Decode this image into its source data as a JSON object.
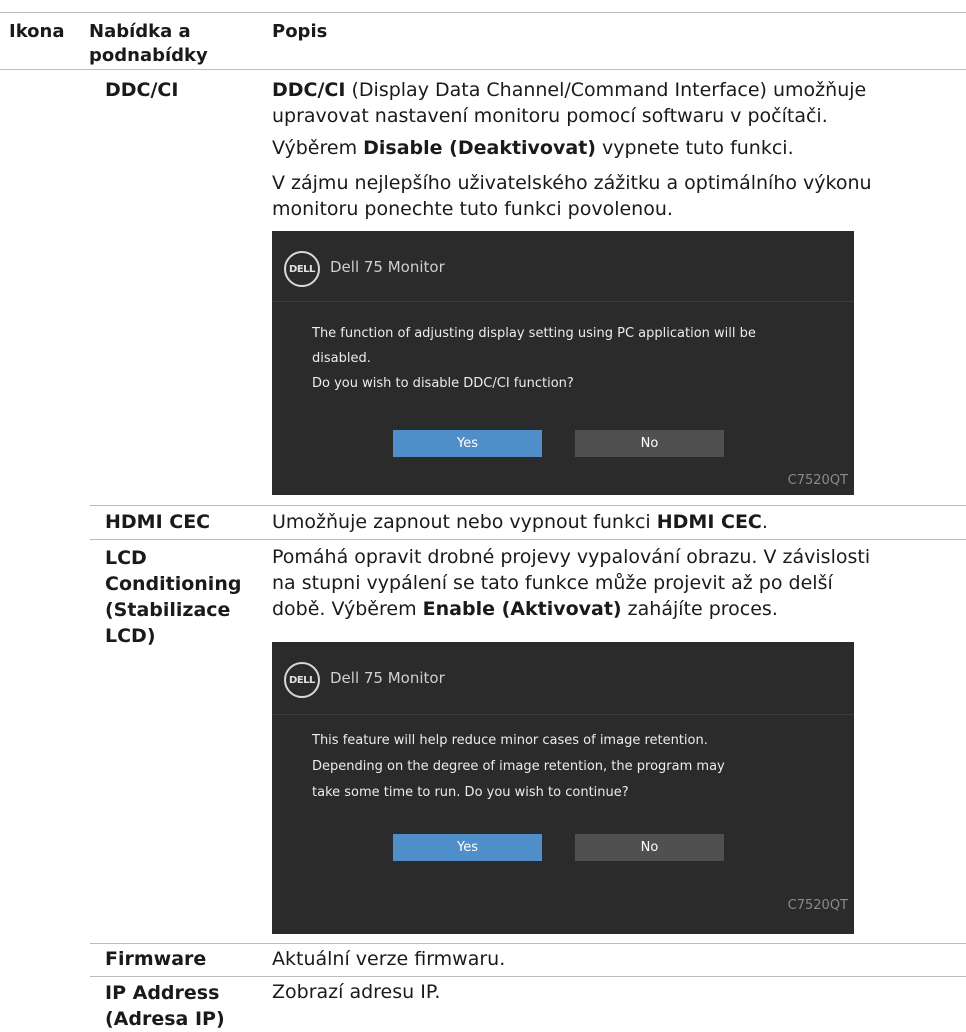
{
  "header": {
    "icon_col": "Ikona",
    "menu_col_1": "Nabídka a",
    "menu_col_2": "podnabídky",
    "desc_col": "Popis"
  },
  "rows": {
    "ddc": {
      "name": "DDC/CI",
      "p1_bold": "DDC/CI",
      "p1_line1_rest": " (Display Data Channel/Command Interface) umožňuje",
      "p1_line2": "upravovat nastavení monitoru pomocí softwaru v počítači.",
      "p2_pre": "Výběrem ",
      "p2_bold": "Disable (Deaktivovat)",
      "p2_post": " vypnete tuto funkci.",
      "p3_line1": "V zájmu nejlepšího uživatelského zážitku a optimálního výkonu",
      "p3_line2": "monitoru ponechte tuto funkci povolenou."
    },
    "hdmi": {
      "name": "HDMI CEC",
      "pre": "Umožňuje zapnout nebo vypnout funkci ",
      "bold": "HDMI CEC",
      "post": "."
    },
    "lcd": {
      "name_1": "LCD",
      "name_2": "Conditioning",
      "name_3": "(Stabilizace",
      "name_4": "LCD)",
      "line1": "Pomáhá opravit drobné projevy vypalování obrazu. V závislosti",
      "line2": "na stupni vypálení se tato funkce může projevit až po delší",
      "line3_pre": "době. Výběrem ",
      "line3_bold": "Enable (Aktivovat)",
      "line3_post": " zahájíte proces."
    },
    "firmware": {
      "name": "Firmware",
      "desc": "Aktuální verze firmwaru."
    },
    "ip": {
      "name_1": "IP Address",
      "name_2": "(Adresa IP)",
      "desc": "Zobrazí adresu IP."
    }
  },
  "osd1": {
    "logo": "DELL",
    "title": "Dell 75 Monitor",
    "msg_1": "The function of adjusting display setting using PC application will be",
    "msg_2": "disabled.",
    "msg_3": "Do you wish to disable DDC/CI function?",
    "yes": "Yes",
    "no": "No",
    "model": "C7520QT"
  },
  "osd2": {
    "logo": "DELL",
    "title": "Dell 75 Monitor",
    "msg_1": "This feature will help reduce minor cases of image retention.",
    "msg_2": "Depending on the degree of image retention, the program may",
    "msg_3": "take some time to run. Do you wish to continue?",
    "yes": "Yes",
    "no": "No",
    "model": "C7520QT"
  },
  "colors": {
    "osd_bg": "#2b2b2b",
    "yes_button": "#4f8ec9",
    "no_button": "#505050",
    "rule": "#bdbdbd"
  }
}
